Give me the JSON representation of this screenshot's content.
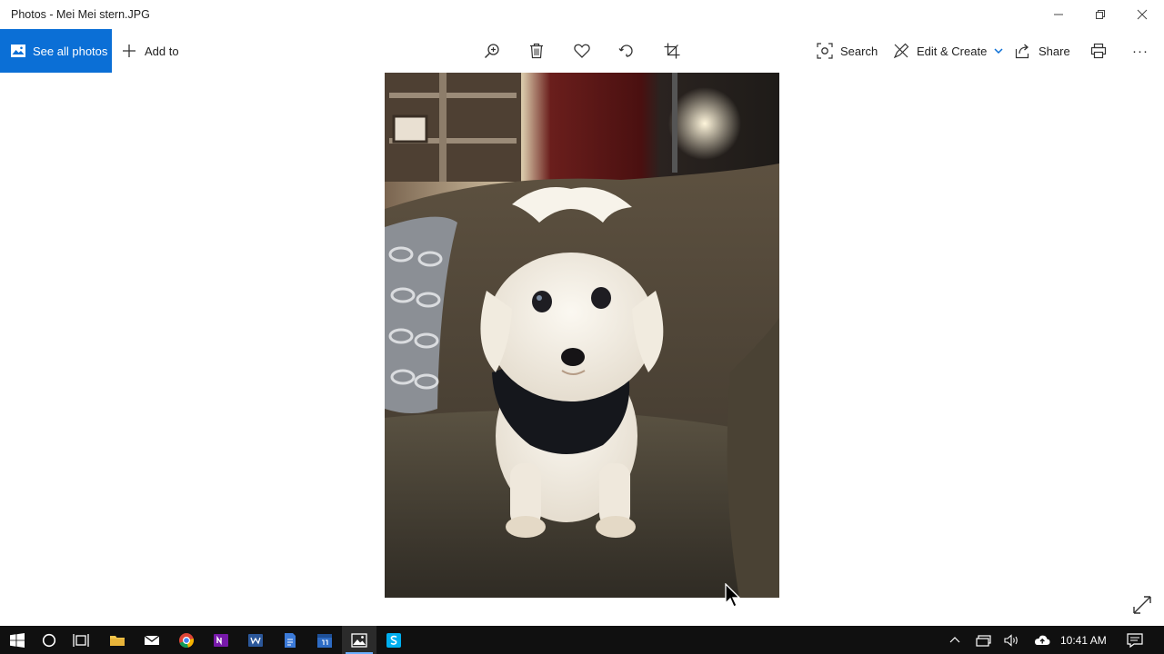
{
  "window": {
    "title": "Photos - Mei Mei stern.JPG"
  },
  "toolbar": {
    "see_all_label": "See all photos",
    "add_to_label": "Add to",
    "search_label": "Search",
    "edit_create_label": "Edit & Create",
    "share_label": "Share",
    "more_label": "···"
  },
  "photo": {
    "subject": "dog-on-couch"
  },
  "taskbar": {
    "apps": [
      "start",
      "cortana",
      "task-view",
      "file-explorer",
      "mail",
      "chrome",
      "onenote",
      "word",
      "notes",
      "calendar",
      "photos",
      "skype"
    ],
    "active_app": "photos",
    "clock": "10:41 AM"
  },
  "colors": {
    "accent": "#0b6fd6",
    "taskbar": "#101010"
  }
}
